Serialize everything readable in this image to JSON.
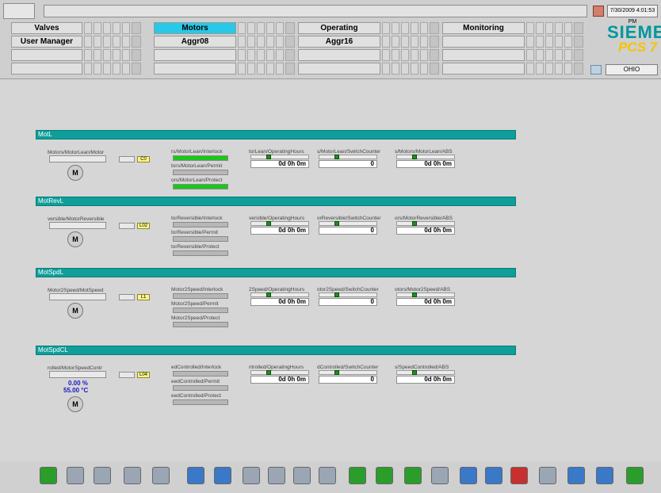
{
  "header": {
    "datetime": "7/30/2009 4:01:53 PM",
    "brand": "SIEMENS",
    "product": "PCS 7",
    "server": "OHIO"
  },
  "areas": {
    "row1": [
      "Valves",
      "Motors",
      "Operating",
      "Monitoring"
    ],
    "row2": [
      "User Manager",
      "Aggr08",
      "Aggr16",
      ""
    ]
  },
  "groups": [
    {
      "title": "MotL",
      "motor_tag": "Motors/MotorLean/Motor",
      "motor_label": "M",
      "alias_tag": "C0",
      "interlock": "rs/MotorLean/Interlock",
      "permit": "tors/MotorLean/Permit",
      "protect": "ors/MotorLean/Protect",
      "op_hours": "torLean/OperatingHours",
      "op_value": "0d  0h  0m",
      "switch": "s/MotorLean/SwitchCounter",
      "switch_value": "0",
      "abs": "s/Motors/MotorLean/ABS",
      "abs_value": "0d  0h  0m"
    },
    {
      "title": "MotRevL",
      "motor_tag": "versible/MotorReversible",
      "motor_label": "M",
      "alias_tag": "L02",
      "interlock": "torReversible/Interlock",
      "permit": "torReversible/Permit",
      "protect": "torReversible/Protect",
      "op_hours": "versible/OperatingHours",
      "op_value": "0d  0h  0m",
      "switch": "orReversible/SwitchCounter",
      "switch_value": "0",
      "abs": "ors/MotorReversible/ABS",
      "abs_value": "0d  0h  0m"
    },
    {
      "title": "MotSpdL",
      "motor_tag": "Motor2Speed/MotSpeed",
      "motor_label": "M",
      "alias_tag": "L1",
      "interlock": "Motor2Speed/Interlock",
      "permit": "Motor2Speed/Permit",
      "protect": "Motor2Speed/Protect",
      "op_hours": "2Speed/OperatingHours",
      "op_value": "0d  0h  0m",
      "switch": "otor2Speed/SwitchCounter",
      "switch_value": "0",
      "abs": "otors/Motor2Speed/ABS",
      "abs_value": "0d  0h  0m"
    },
    {
      "title": "MotSpdCL",
      "motor_tag": "rolled/MotorSpeedContr",
      "motor_label": "M",
      "alias_tag": "L04",
      "pct": "0.00 %",
      "temp": "55.00 °C",
      "interlock": "edControlled/Interlock",
      "permit": "eedControlled/Permit",
      "protect": "eedControlled/Protect",
      "op_hours": "ntrolled/OperatingHours",
      "op_value": "0d  0h  0m",
      "switch": "dControlled/SwitchCounter",
      "switch_value": "0",
      "abs": "s/SpeedControlled/ABS",
      "abs_value": "0d  0h  0m"
    }
  ],
  "toolbar": {
    "icons": [
      "start-icon",
      "key-icon",
      "folder-icon",
      "overview-icon",
      "trend-icon",
      "picture-tree-icon",
      "message-list-icon",
      "arrow-left-icon",
      "arrow-up-icon",
      "arrow-down-icon",
      "arrow-right-icon",
      "back-icon",
      "forward-icon",
      "select-picture-icon",
      "next-picture-icon",
      "print-icon",
      "save-icon",
      "delete-icon",
      "keyboard-icon",
      "help-icon",
      "horn-icon",
      "ack-icon"
    ],
    "colors": {
      "green": "#2a9d2a",
      "blue": "#3a78c8",
      "grey": "#9aa6b4",
      "red": "#c83030"
    }
  }
}
